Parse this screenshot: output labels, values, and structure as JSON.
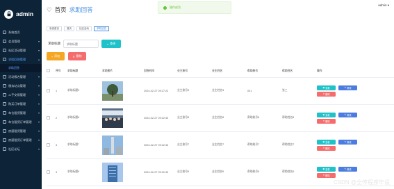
{
  "sidebar": {
    "brand": "admin",
    "items": [
      {
        "label": "系统首页",
        "active": false,
        "has_children": false
      },
      {
        "label": "会员管理",
        "active": false,
        "has_children": true
      },
      {
        "label": "社区活动管理",
        "active": false,
        "has_children": true
      },
      {
        "label": "求助回答管理",
        "active": true,
        "has_children": true
      },
      {
        "label": "活动报名管理",
        "active": false,
        "has_children": true
      },
      {
        "label": "服务站点管理",
        "active": false,
        "has_children": true
      },
      {
        "label": "二手交易管理",
        "active": false,
        "has_children": true
      },
      {
        "label": "购买订单管理",
        "active": false,
        "has_children": true
      },
      {
        "label": "车位租赁管理",
        "active": false,
        "has_children": true
      },
      {
        "label": "车位租赁订单管理",
        "active": false,
        "has_children": true
      },
      {
        "label": "房屋租赁管理",
        "active": false,
        "has_children": true
      },
      {
        "label": "房屋租赁订单管理",
        "active": false,
        "has_children": true
      },
      {
        "label": "社区论坛",
        "active": false,
        "has_children": true
      }
    ],
    "submenu": [
      "求助回答"
    ]
  },
  "header": {
    "home": "首页",
    "page": "求助回答",
    "toast": "操作成功",
    "user": "admin"
  },
  "tabs": [
    "系统首页",
    "首页",
    "社区活动",
    "求助回答"
  ],
  "search": {
    "label": "求助标题",
    "placeholder": "求助标题",
    "button": "查询"
  },
  "actions": {
    "add": "添加",
    "delete": "删除"
  },
  "table": {
    "headers": [
      "序号",
      "求助标题",
      "求助图片",
      "回答时间",
      "业主账号",
      "业主姓名",
      "帮助账号",
      "帮助姓名",
      "操作"
    ],
    "rows": [
      {
        "index": "1",
        "title": "求助标题3",
        "time": "2024-02-27 09:27:22",
        "owner_account": "业主账号3",
        "owner_name": "业主姓名3",
        "helper_account": "001",
        "helper_name": "张三",
        "img": "tree"
      },
      {
        "index": "2",
        "title": "求助标题8",
        "time": "2024-02-27 09:22:43",
        "owner_account": "业主账号8",
        "owner_name": "业主姓名8",
        "helper_account": "帮助账号8",
        "helper_name": "帮助姓名8",
        "img": "crowd"
      },
      {
        "index": "3",
        "title": "求助标题7",
        "time": "2024-02-27 09:22:43",
        "owner_account": "业主账号7",
        "owner_name": "业主姓名7",
        "helper_account": "帮助账号7",
        "helper_name": "帮助姓名7",
        "img": "tower"
      },
      {
        "index": "4",
        "title": "求助标题6",
        "time": "2024-02-27 09:22:43",
        "owner_account": "业主账号6",
        "owner_name": "业主姓名6",
        "helper_account": "帮助账号6",
        "helper_name": "帮助姓名6",
        "img": "building"
      }
    ],
    "ops": {
      "view": "查看",
      "edit": "修改",
      "delete": "删除"
    }
  },
  "watermark": "CSDN @全传程序毕设",
  "colors": {
    "sidebar": "#0d2438",
    "accent": "#4a90e2",
    "teal": "#1fc2c8",
    "orange": "#f5a623",
    "red": "#f56c6c",
    "blue": "#4a7ddf"
  }
}
